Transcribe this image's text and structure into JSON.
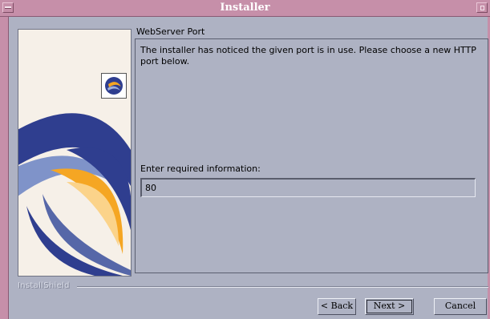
{
  "window": {
    "title": "Installer"
  },
  "section": {
    "title": "WebServer Port"
  },
  "message": "The installer has noticed the given port is in use. Please choose a new HTTP port below.",
  "form": {
    "prompt": "Enter required information:",
    "port_value": "80"
  },
  "brand": "InstallShield",
  "buttons": {
    "back": "< Back",
    "next": "Next >",
    "cancel": "Cancel"
  },
  "colors": {
    "titlebar": "#c68fa9",
    "panel_bg": "#aeb2c3",
    "swirl_dark": "#2f3e8f",
    "swirl_light": "#7f93c9",
    "swirl_orange": "#f5a623"
  },
  "icons": {
    "installer_logo": "installshield-logo-icon"
  }
}
